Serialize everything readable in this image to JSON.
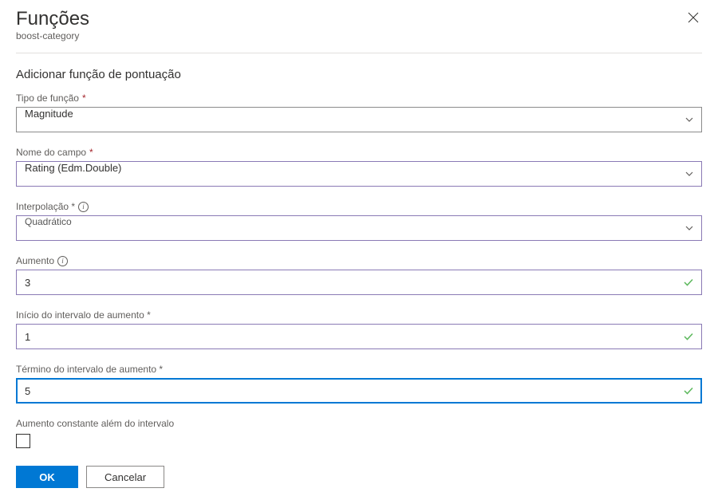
{
  "header": {
    "title": "Funções",
    "subtitle": "boost-category"
  },
  "section_title": "Adicionar função de pontuação",
  "fields": {
    "function_type": {
      "label": "Tipo de função",
      "value": "Magnitude"
    },
    "field_name": {
      "label": "Nome do campo",
      "value": "Rating (Edm.Double)"
    },
    "interpolation": {
      "label": "Interpolação *",
      "value": "Quadrático"
    },
    "boost": {
      "label": "Aumento",
      "value": "3"
    },
    "range_start": {
      "label": "Início do intervalo de aumento *",
      "value": "1"
    },
    "range_end": {
      "label": "Término do intervalo de aumento *",
      "value": "5"
    },
    "constant_boost": {
      "label": "Aumento constante além do intervalo"
    }
  },
  "buttons": {
    "ok": "OK",
    "cancel": "Cancelar"
  }
}
